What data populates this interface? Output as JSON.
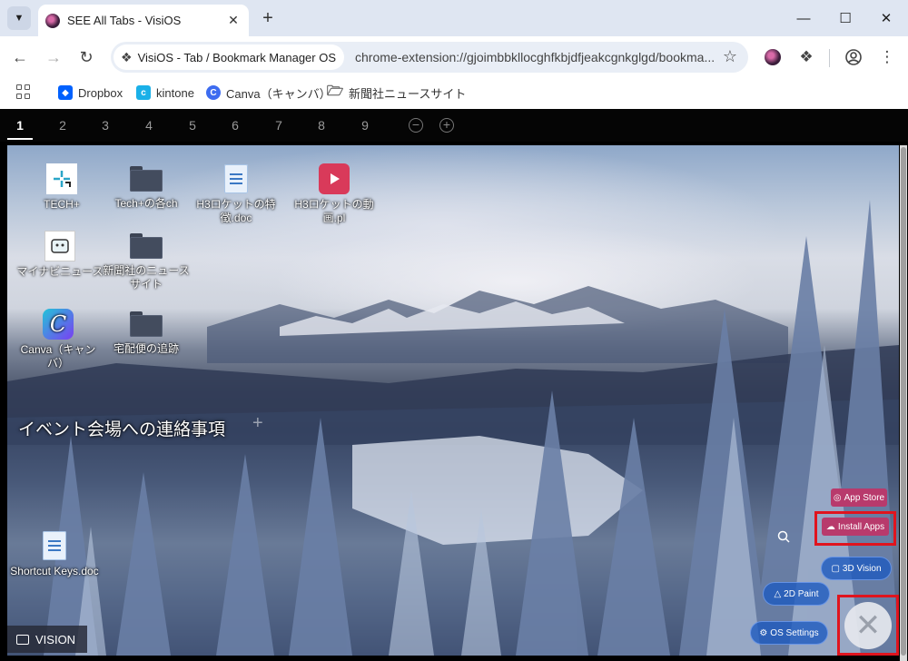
{
  "browser": {
    "tab_title": "SEE All Tabs - VisiOS",
    "site_name": "VisiOS - Tab / Bookmark Manager OS",
    "url": "chrome-extension://gjoimbbkllocghfkbjdfjeakcgnkglgd/bookma...",
    "bookmarks": [
      {
        "label": "Dropbox",
        "icon": "dropbox-icon",
        "color": "#0061fe"
      },
      {
        "label": "kintone",
        "icon": "kintone-icon",
        "color": "#1ab0e8"
      },
      {
        "label": "Canva（キャンバ）",
        "icon": "canva-icon",
        "color": "#3d6cf0"
      },
      {
        "label": "新聞社ニュースサイト",
        "icon": "folder-icon",
        "color": "#555555"
      }
    ]
  },
  "workspace_tabs": [
    "1",
    "2",
    "3",
    "4",
    "5",
    "6",
    "7",
    "8",
    "9"
  ],
  "active_workspace": "1",
  "desktop_icons": [
    {
      "label": "TECH+",
      "type": "app"
    },
    {
      "label": "Tech+の各ch",
      "type": "folder"
    },
    {
      "label": "H3ロケットの特徴.doc",
      "type": "doc"
    },
    {
      "label": "H3ロケットの動画.pl",
      "type": "playlist"
    },
    {
      "label": "マイナビニュース",
      "type": "app"
    },
    {
      "label": "新聞社のニュースサイト",
      "type": "folder"
    },
    {
      "label": "Canva（キャンバ）",
      "type": "app"
    },
    {
      "label": "宅配便の追跡",
      "type": "folder"
    }
  ],
  "section_title": "イベント会場への連絡事項",
  "section_icons": [
    {
      "label": "Shortcut Keys.doc",
      "type": "doc"
    }
  ],
  "menu": {
    "app_store": "App Store",
    "install_apps": "Install Apps",
    "vision_3d": "3D Vision",
    "paint_2d": "2D Paint",
    "os_settings": "OS Settings"
  },
  "taskbar_label": "VISION",
  "colors": {
    "highlight": "#e0141e",
    "pill_pink": "#b83a6c",
    "pill_blue": "#1e5abe"
  }
}
